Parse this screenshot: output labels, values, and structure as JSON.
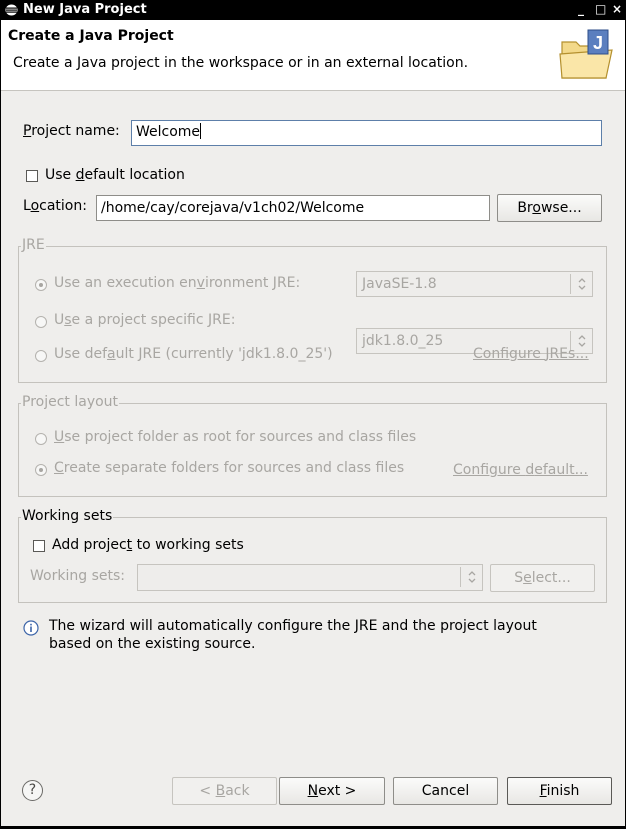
{
  "window": {
    "title": "New Java Project",
    "minimize": "_",
    "maximize": "□",
    "close": "×"
  },
  "banner": {
    "title": "Create a Java Project",
    "description": "Create a Java project in the workspace or in an external location."
  },
  "project_name": {
    "label_u": "P",
    "label_rest": "roject name:",
    "value": "Welcome"
  },
  "default_location": {
    "label_pre": "Use ",
    "label_u": "d",
    "label_post": "efault location",
    "checked": false
  },
  "location": {
    "label_pre": "L",
    "label_u": "o",
    "label_post": "cation:",
    "value": "/home/cay/corejava/v1ch02/Welcome"
  },
  "browse_button": {
    "pre": "Br",
    "u": "o",
    "post": "wse..."
  },
  "jre": {
    "title": "JRE",
    "option1": {
      "pre": "Use an execution en",
      "u": "v",
      "post": "ironment JRE:",
      "selected": true
    },
    "option1_combo": "JavaSE-1.8",
    "option2": {
      "pre": "U",
      "u": "s",
      "post": "e a project specific JRE:",
      "selected": false
    },
    "option2_combo": "jdk1.8.0_25",
    "option3": {
      "pre": "Use def",
      "u": "a",
      "post": "ult JRE (currently 'jdk1.8.0_25')",
      "selected": false
    },
    "configure_link": {
      "pre": "Configure ",
      "u": "J",
      "post": "REs..."
    }
  },
  "project_layout": {
    "title": "Project layout",
    "option1": {
      "pre": "",
      "u": "U",
      "post": "se project folder as root for sources and class files",
      "selected": false
    },
    "option2": {
      "pre": "",
      "u": "C",
      "post": "reate separate folders for sources and class files",
      "selected": true
    },
    "configure_link": {
      "pre": "Configure ",
      "u": "d",
      "post": "efault..."
    }
  },
  "working_sets": {
    "title": "Working sets",
    "add_checkbox": {
      "pre": "Add projec",
      "u": "t",
      "post": " to working sets",
      "checked": false
    },
    "label_pre": "W",
    "label_u": "o",
    "label_post": "rking sets:",
    "combo_value": "",
    "select_button": {
      "pre": "S",
      "u": "e",
      "post": "lect..."
    }
  },
  "info": {
    "line1": "The wizard will automatically configure the JRE and the project layout",
    "line2": "based on the existing source."
  },
  "footer": {
    "help": "?",
    "back": {
      "pre": "< ",
      "u": "B",
      "post": "ack"
    },
    "next": {
      "pre": "",
      "u": "N",
      "post": "ext >"
    },
    "cancel": "Cancel",
    "finish": {
      "pre": "",
      "u": "F",
      "post": "inish"
    }
  }
}
